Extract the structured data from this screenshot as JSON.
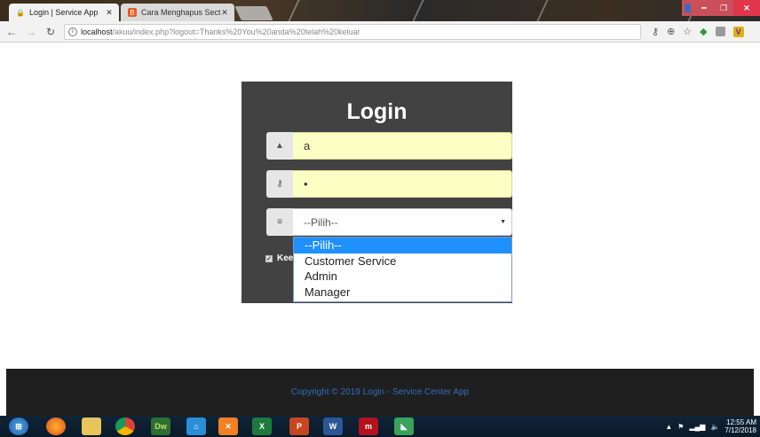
{
  "browser": {
    "tabs": [
      {
        "label": "Login | Service App",
        "active": true,
        "favicon": "lock-icon"
      },
      {
        "label": "Cara Menghapus Section",
        "active": false,
        "favicon": "blogger-icon"
      }
    ],
    "url_host": "localhost",
    "url_path": "/akuu/index.php?logout=Thanks%20You%20anda%20telah%20keluar",
    "toolbar_icons": [
      "key-icon",
      "zoom-icon",
      "star-icon",
      "extension-green-icon",
      "extension-gray-icon",
      "extension-yellow-icon"
    ]
  },
  "login": {
    "title": "Login",
    "username_value": "a",
    "password_value": "•",
    "role_selected": "--Pilih--",
    "role_options": [
      "--Pilih--",
      "Customer Service",
      "Admin",
      "Manager"
    ],
    "remember_label": "Kee"
  },
  "footer": {
    "text": "Copyright © 2019 Login - Service Center App"
  },
  "taskbar": {
    "apps": [
      "start-orb",
      "firefox",
      "explorer",
      "chrome",
      "dreamweaver",
      "network",
      "xampp",
      "excel",
      "powerpoint",
      "word",
      "filezilla",
      "app-green"
    ],
    "app_labels": {
      "dreamweaver": "Dw",
      "excel": "X",
      "powerpoint": "P",
      "word": "W"
    },
    "clock_time": "12:55 AM",
    "clock_date": "7/12/2018"
  },
  "colors": {
    "login_bg": "#424242",
    "input_fill": "#fbffc3",
    "footer_bg": "#1f1f1f",
    "footer_text": "#2f6fbf",
    "dropdown_highlight": "#1e90ff"
  }
}
